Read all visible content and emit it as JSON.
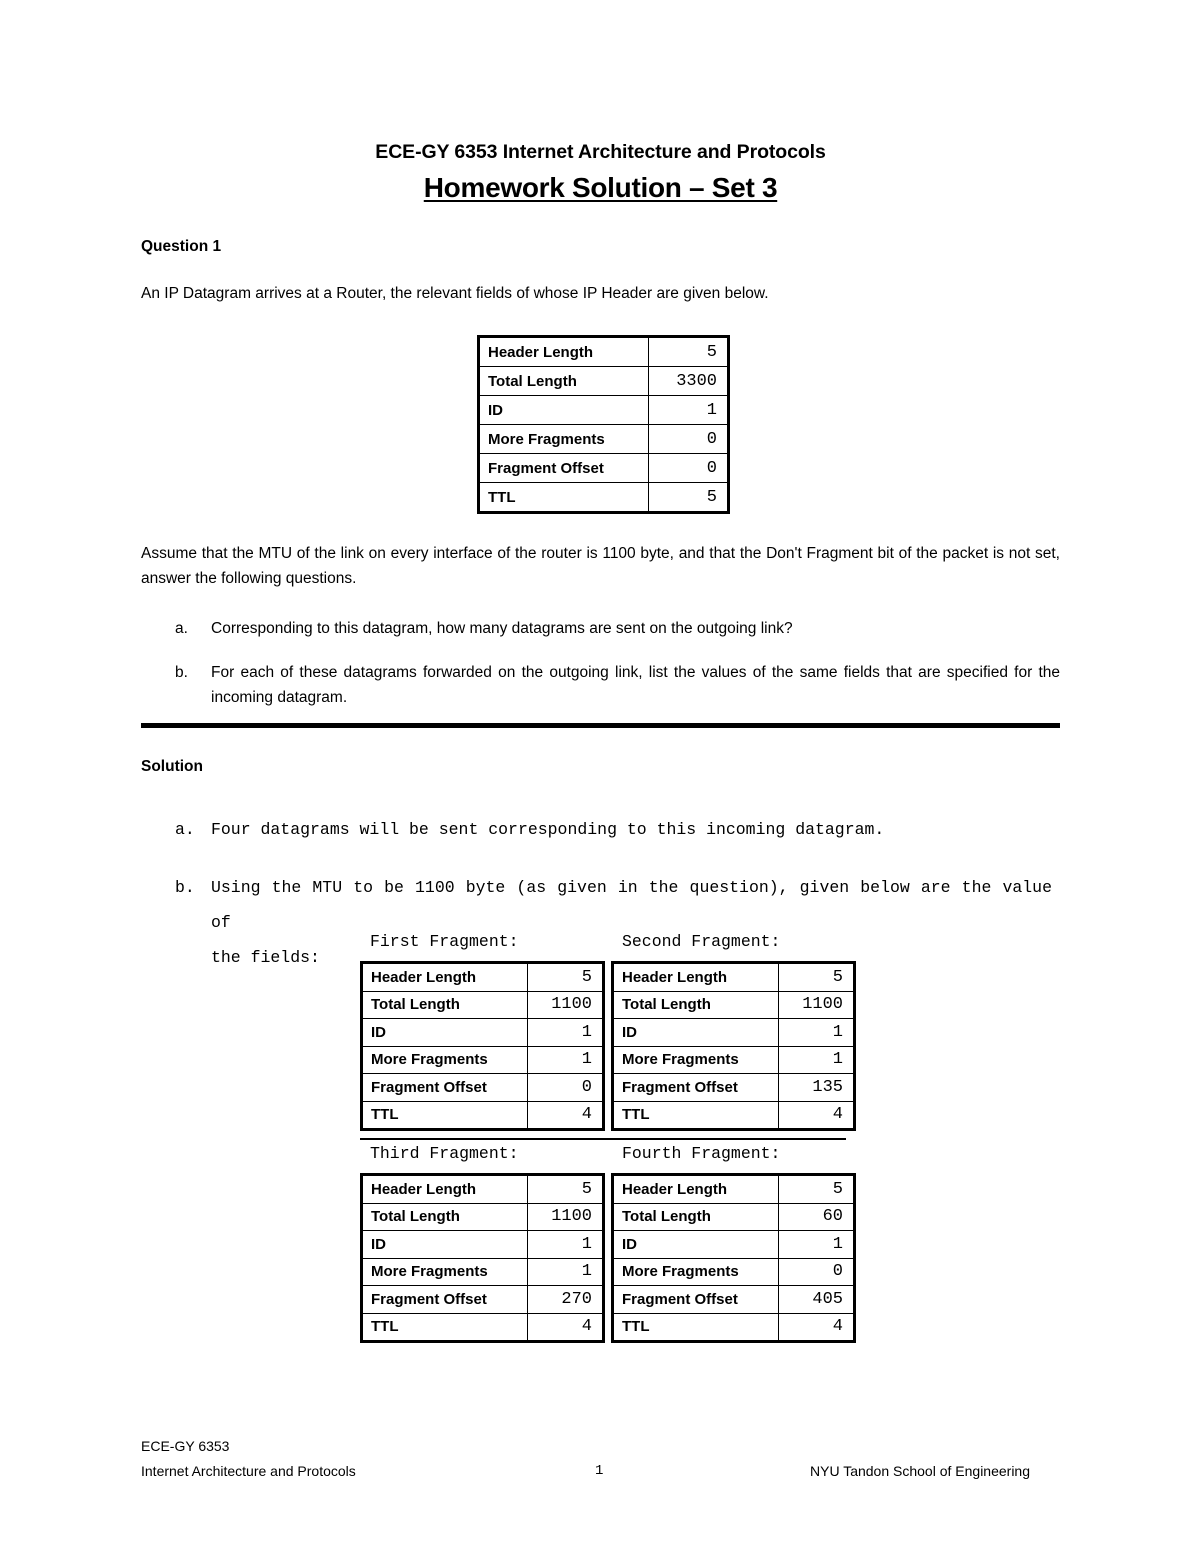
{
  "document": {
    "subtitle": "ECE-GY 6353 Internet Architecture and Protocols",
    "title": "Homework Solution – Set 3"
  },
  "question": {
    "heading": "Question 1",
    "intro": "An IP Datagram arrives at a Router, the relevant fields of whose IP Header are given below.",
    "assumption": "Assume that the MTU of the link on every interface of the router is 1100 byte, and that the Don't Fragment bit of the packet is not set, answer the following questions.",
    "items": [
      {
        "marker": "a.",
        "text": "Corresponding to this datagram, how many datagrams are sent on the outgoing link?"
      },
      {
        "marker": "b.",
        "text": "For each of these datagrams forwarded on the outgoing link, list the values of the same fields that are specified for the incoming datagram."
      }
    ]
  },
  "incoming_table": {
    "fields": [
      "Header Length",
      "Total Length",
      "ID",
      "More Fragments",
      "Fragment Offset",
      "TTL"
    ],
    "values": [
      "5",
      "3300",
      "1",
      "0",
      "0",
      "5"
    ]
  },
  "solution": {
    "heading": "Solution",
    "items": [
      {
        "marker": "a.",
        "text": "Four datagrams will be sent corresponding to this incoming datagram."
      },
      {
        "marker": "b.",
        "line1": "Using the MTU to be 1100 byte (as given in the question), given below are the value of",
        "line2": "the fields:"
      }
    ]
  },
  "fragments": [
    {
      "caption": "First Fragment:",
      "fields": [
        "Header Length",
        "Total Length",
        "ID",
        "More Fragments",
        "Fragment Offset",
        "TTL"
      ],
      "values": [
        "5",
        "1100",
        "1",
        "1",
        "0",
        "4"
      ]
    },
    {
      "caption": "Second Fragment:",
      "fields": [
        "Header Length",
        "Total Length",
        "ID",
        "More Fragments",
        "Fragment Offset",
        "TTL"
      ],
      "values": [
        "5",
        "1100",
        "1",
        "1",
        "135",
        "4"
      ]
    },
    {
      "caption": "Third Fragment:",
      "fields": [
        "Header Length",
        "Total Length",
        "ID",
        "More Fragments",
        "Fragment Offset",
        "TTL"
      ],
      "values": [
        "5",
        "1100",
        "1",
        "1",
        "270",
        "4"
      ]
    },
    {
      "caption": "Fourth Fragment:",
      "fields": [
        "Header Length",
        "Total Length",
        "ID",
        "More Fragments",
        "Fragment Offset",
        "TTL"
      ],
      "values": [
        "5",
        "60",
        "1",
        "0",
        "405",
        "4"
      ]
    }
  ],
  "footer": {
    "course": "ECE-GY 6353",
    "subject": "Internet Architecture and Protocols",
    "page_number": "1",
    "school": "NYU Tandon School of Engineering"
  }
}
